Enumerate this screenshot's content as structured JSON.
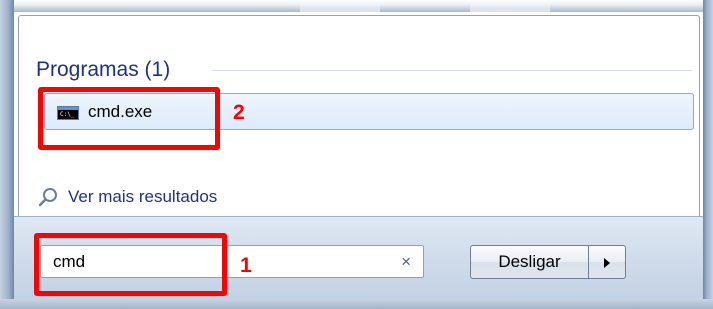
{
  "start_menu": {
    "section_title": "Programas (1)",
    "result": {
      "label": "cmd.exe",
      "icon": "console-icon"
    },
    "more_results": {
      "label": "Ver mais resultados",
      "icon": "search-magnifier-icon"
    }
  },
  "search": {
    "value": "cmd",
    "clear_icon": "×"
  },
  "shutdown": {
    "label": "Desligar",
    "arrow_icon": "triangle-right-icon"
  },
  "annotations": [
    {
      "label": "1",
      "target": "search-box"
    },
    {
      "label": "2",
      "target": "cmd-result"
    }
  ],
  "colors": {
    "annotation": "#ff0000",
    "link": "#1e3287",
    "highlight_border": "#84acdd"
  }
}
